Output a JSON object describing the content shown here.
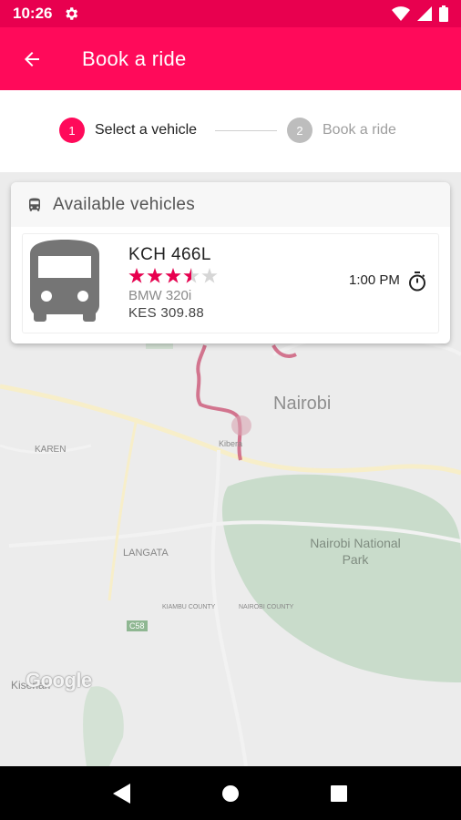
{
  "status_bar": {
    "time": "10:26"
  },
  "app_bar": {
    "title": "Book a ride"
  },
  "stepper": {
    "steps": [
      {
        "number": "1",
        "label": "Select a vehicle"
      },
      {
        "number": "2",
        "label": "Book a ride"
      }
    ]
  },
  "card": {
    "header_title": "Available vehicles",
    "vehicle": {
      "plate": "KCH 466L",
      "rating": 3.5,
      "rating_max": 5,
      "model": "BMW 320i",
      "price": "KES 309.88",
      "time": "1:00 PM"
    }
  },
  "map": {
    "labels": {
      "nairobi": "Nairobi",
      "karen": "KAREN",
      "langata": "LANGATA",
      "kibera": "Kibera",
      "park": "Nairobi National Park",
      "county_a": "KIAMBU COUNTY",
      "county_b": "NAIROBI COUNTY",
      "road": "C58",
      "kiserian": "Kiserian"
    },
    "attribution": "Google"
  },
  "colors": {
    "primary": "#ff0a5a",
    "primary_dark": "#e8004f",
    "star": "#e8004f",
    "inactive": "#bdbdbd",
    "park_green": "#c9dccb"
  }
}
